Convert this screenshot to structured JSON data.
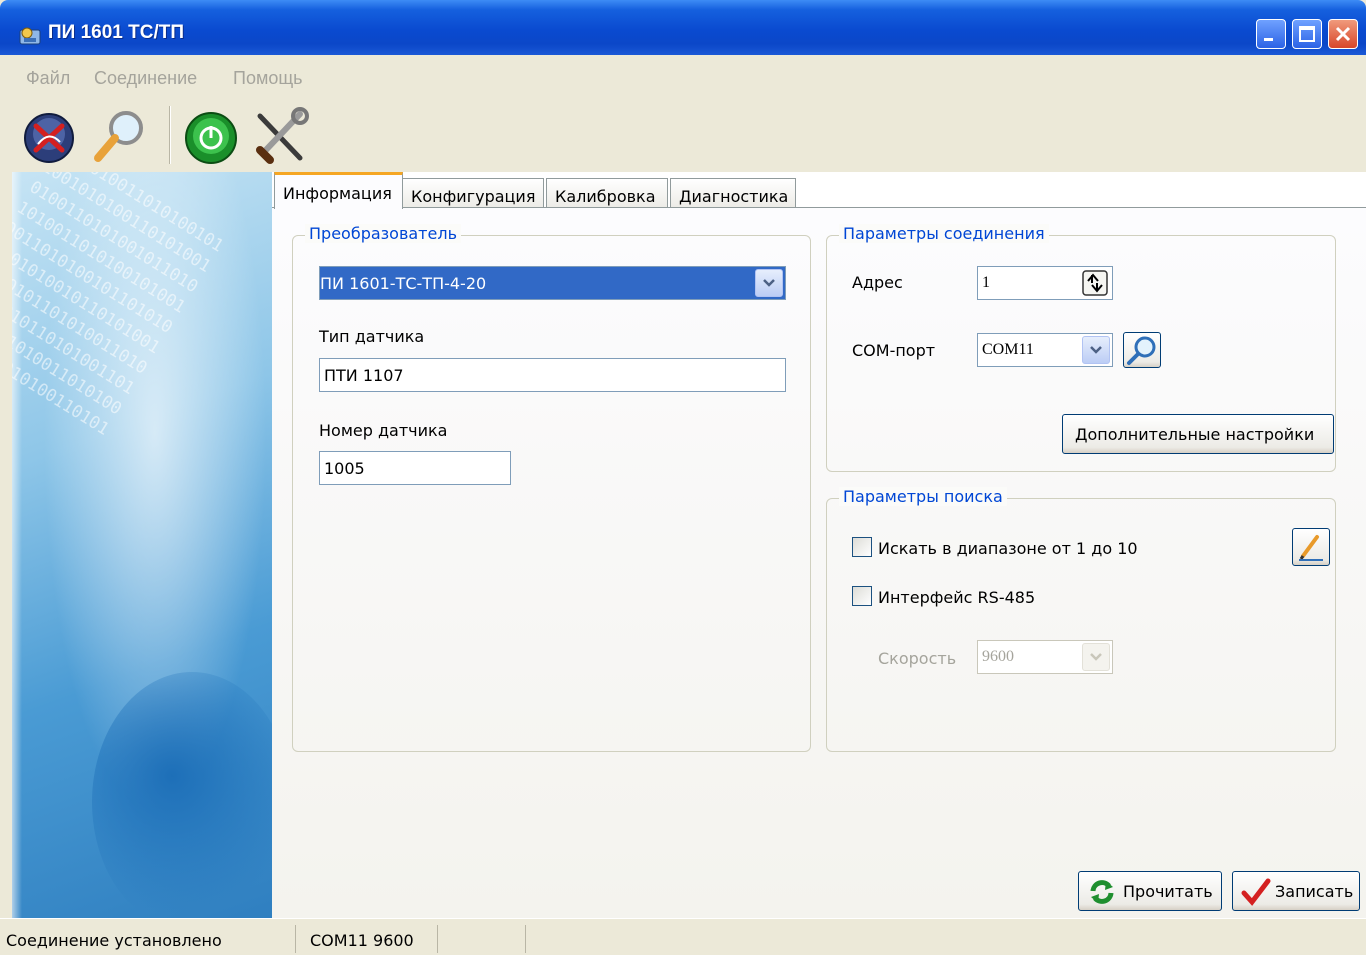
{
  "window": {
    "title": "ПИ 1601 ТС/ТП"
  },
  "menu": {
    "items": [
      "Файл",
      "Соединение",
      "Помощь"
    ]
  },
  "toolbar": {
    "icons": [
      "disconnect-icon",
      "search-icon",
      "power-icon",
      "tools-icon"
    ]
  },
  "tabs": [
    {
      "label": "Информация",
      "active": true
    },
    {
      "label": "Конфигурация",
      "active": false
    },
    {
      "label": "Калибровка",
      "active": false
    },
    {
      "label": "Диагностика",
      "active": false
    }
  ],
  "converter": {
    "title": "Преобразователь",
    "model_value": "ПИ 1601-ТС-ТП-4-20",
    "sensor_type_label": "Тип датчика",
    "sensor_type_value": "ПТИ 1107",
    "sensor_number_label": "Номер датчика",
    "sensor_number_value": "1005"
  },
  "connection": {
    "title": "Параметры соединения",
    "address_label": "Адрес",
    "address_value": "1",
    "com_label": "COM-порт",
    "com_value": "COM11",
    "advanced_button": "Дополнительные настройки"
  },
  "search": {
    "title": "Параметры поиска",
    "range_label": "Искать в диапазоне от 1 до 10",
    "range_checked": false,
    "rs485_label": "Интерфейс RS-485",
    "rs485_checked": false,
    "speed_label": "Скорость",
    "speed_value": "9600"
  },
  "actions": {
    "read": "Прочитать",
    "write": "Записать"
  },
  "status": {
    "connection": "Соединение установлено",
    "port": "COM11 9600"
  },
  "colors": {
    "title_blue": "#0a4ad0",
    "group_title": "#0046d5",
    "selection": "#3169c6",
    "tab_accent": "#f5a623"
  }
}
